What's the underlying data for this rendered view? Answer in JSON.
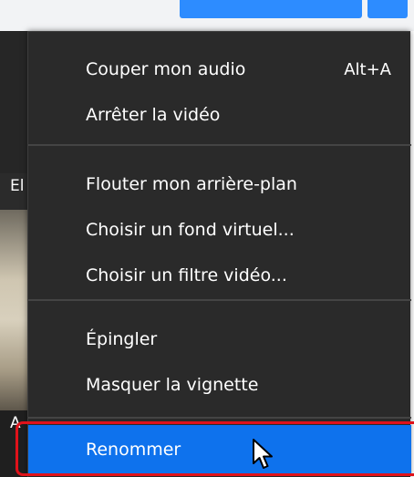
{
  "top_bar": {
    "button_color": "#2d8cff"
  },
  "background": {
    "label_top": "El",
    "label_bottom": "A"
  },
  "menu": {
    "groups": [
      {
        "items": [
          {
            "label": "Couper mon audio",
            "shortcut": "Alt+A"
          },
          {
            "label": "Arrêter la vidéo"
          }
        ]
      },
      {
        "items": [
          {
            "label": "Flouter mon arrière-plan"
          },
          {
            "label": "Choisir un fond virtuel..."
          },
          {
            "label": "Choisir un filtre vidéo..."
          }
        ]
      },
      {
        "items": [
          {
            "label": "Épingler"
          },
          {
            "label": "Masquer la vignette"
          }
        ]
      }
    ],
    "highlighted_item": {
      "label": "Renommer"
    },
    "colors": {
      "menu_background": "#2a2a2a",
      "highlight": "#0e72ed",
      "annotation_frame": "#e0121a"
    }
  },
  "cursor": {
    "icon": "arrow-pointer-icon"
  }
}
